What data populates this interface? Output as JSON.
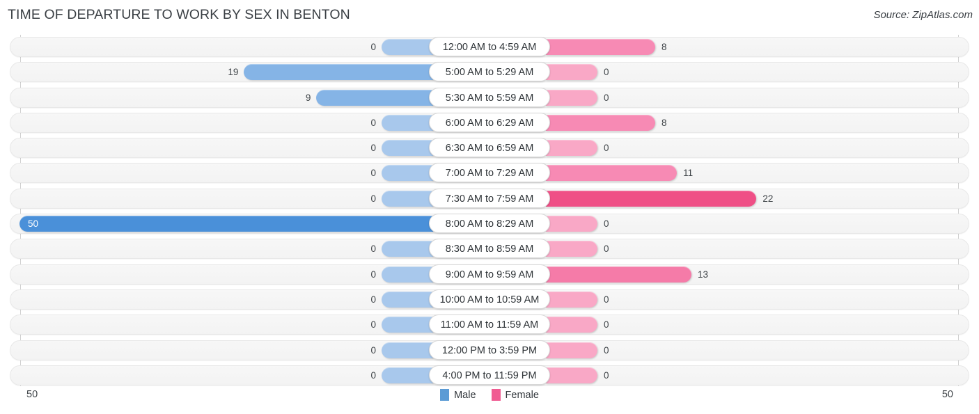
{
  "header": {
    "title": "TIME OF DEPARTURE TO WORK BY SEX IN BENTON",
    "source": "Source: ZipAtlas.com"
  },
  "axis": {
    "left_tick": "50",
    "right_tick": "50",
    "max": 50
  },
  "legend": {
    "items": [
      {
        "label": "Male",
        "color": "#5b9bd5"
      },
      {
        "label": "Female",
        "color": "#f05c92"
      }
    ]
  },
  "colors": {
    "male_max": "#4a90d9",
    "male_mid": "#85b4e6",
    "male_zero": "#a8c8ec",
    "female_max": "#ef4f86",
    "female_high": "#f45f96",
    "female_mid": "#f57ba8",
    "female_low": "#f78ab4",
    "female_zero": "#f9a8c6",
    "track": "#f5f5f5",
    "axis": "#d0d0d0"
  },
  "chart_data": {
    "type": "bar",
    "orientation": "horizontal",
    "layout": "diverging-bidirectional",
    "title": "TIME OF DEPARTURE TO WORK BY SEX IN BENTON",
    "xlabel": "",
    "ylabel": "",
    "xlim": [
      50,
      50
    ],
    "grid": false,
    "legend_position": "bottom-center",
    "categories": [
      "12:00 AM to 4:59 AM",
      "5:00 AM to 5:29 AM",
      "5:30 AM to 5:59 AM",
      "6:00 AM to 6:29 AM",
      "6:30 AM to 6:59 AM",
      "7:00 AM to 7:29 AM",
      "7:30 AM to 7:59 AM",
      "8:00 AM to 8:29 AM",
      "8:30 AM to 8:59 AM",
      "9:00 AM to 9:59 AM",
      "10:00 AM to 10:59 AM",
      "11:00 AM to 11:59 AM",
      "12:00 PM to 3:59 PM",
      "4:00 PM to 11:59 PM"
    ],
    "series": [
      {
        "name": "Male",
        "color": "#5b9bd5",
        "direction": "left",
        "values": [
          0,
          19,
          9,
          0,
          0,
          0,
          0,
          50,
          0,
          0,
          0,
          0,
          0,
          0
        ]
      },
      {
        "name": "Female",
        "color": "#f05c92",
        "direction": "right",
        "values": [
          8,
          0,
          0,
          8,
          0,
          11,
          22,
          0,
          0,
          13,
          0,
          0,
          0,
          0
        ]
      }
    ]
  },
  "rows": [
    {
      "category": "12:00 AM to 4:59 AM",
      "male": "0",
      "female": "8"
    },
    {
      "category": "5:00 AM to 5:29 AM",
      "male": "19",
      "female": "0"
    },
    {
      "category": "5:30 AM to 5:59 AM",
      "male": "9",
      "female": "0"
    },
    {
      "category": "6:00 AM to 6:29 AM",
      "male": "0",
      "female": "8"
    },
    {
      "category": "6:30 AM to 6:59 AM",
      "male": "0",
      "female": "0"
    },
    {
      "category": "7:00 AM to 7:29 AM",
      "male": "0",
      "female": "11"
    },
    {
      "category": "7:30 AM to 7:59 AM",
      "male": "0",
      "female": "22"
    },
    {
      "category": "8:00 AM to 8:29 AM",
      "male": "50",
      "female": "0"
    },
    {
      "category": "8:30 AM to 8:59 AM",
      "male": "0",
      "female": "0"
    },
    {
      "category": "9:00 AM to 9:59 AM",
      "male": "0",
      "female": "13"
    },
    {
      "category": "10:00 AM to 10:59 AM",
      "male": "0",
      "female": "0"
    },
    {
      "category": "11:00 AM to 11:59 AM",
      "male": "0",
      "female": "0"
    },
    {
      "category": "12:00 PM to 3:59 PM",
      "male": "0",
      "female": "0"
    },
    {
      "category": "4:00 PM to 11:59 PM",
      "male": "0",
      "female": "0"
    }
  ]
}
